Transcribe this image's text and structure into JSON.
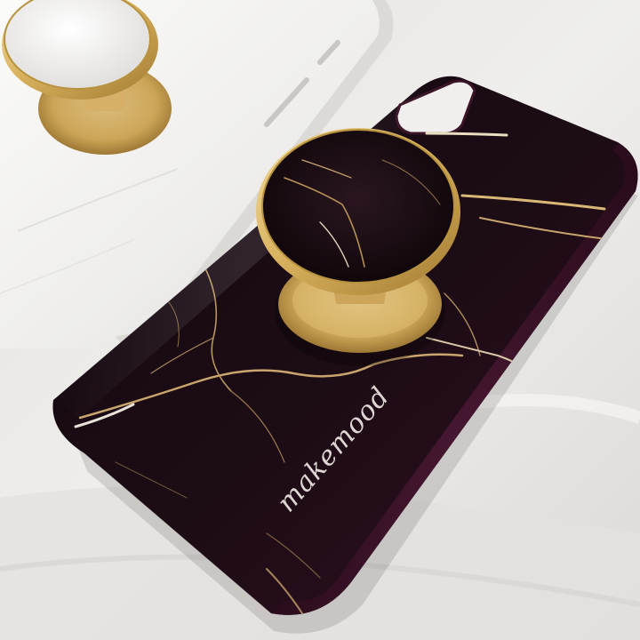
{
  "photo": {
    "subject": "marble-phone-case-with-pop-grip",
    "brand_signature": "makemood",
    "colors": {
      "fabric": "#ecebea",
      "white_case": "#f3f2f0",
      "black_marble": "#1c0d16",
      "gold": "#d8b25e",
      "vein": "#c9a56d"
    }
  }
}
